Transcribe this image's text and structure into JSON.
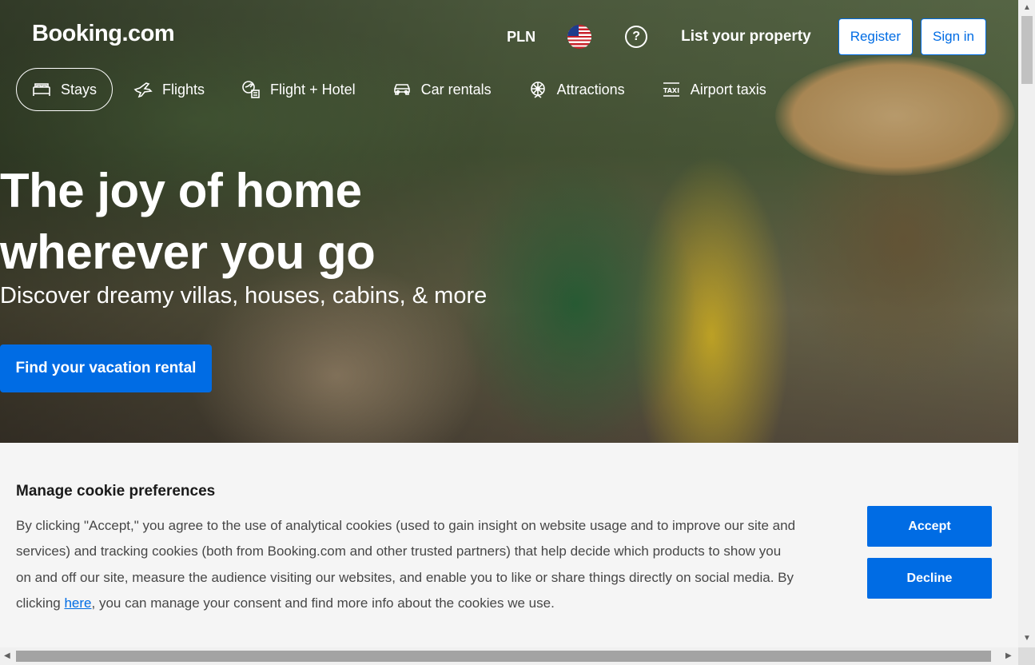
{
  "brand": {
    "logo": "Booking.com"
  },
  "header": {
    "currency": "PLN",
    "help_icon": "?",
    "list_property": "List your property",
    "register": "Register",
    "sign_in": "Sign in"
  },
  "nav": {
    "items": [
      {
        "label": "Stays",
        "icon": "bed-icon"
      },
      {
        "label": "Flights",
        "icon": "plane-icon"
      },
      {
        "label": "Flight + Hotel",
        "icon": "flight-hotel-icon"
      },
      {
        "label": "Car rentals",
        "icon": "car-icon"
      },
      {
        "label": "Attractions",
        "icon": "attractions-icon"
      },
      {
        "label": "Airport taxis",
        "icon": "taxi-icon"
      }
    ]
  },
  "hero": {
    "headline_line1": "The joy of home",
    "headline_line2": "wherever you go",
    "subtitle": "Discover dreamy villas, houses, cabins, & more",
    "cta": "Find your vacation rental"
  },
  "cookie": {
    "title": "Manage cookie preferences",
    "text_before_link": "By clicking \"Accept,\" you agree to the use of analytical cookies (used to gain insight on website usage and to improve our site and services) and tracking cookies (both from Booking.com and other trusted partners) that help decide which products to show you on and off our site, measure the audience visiting our websites, and enable you to like or share things directly on social media. By clicking ",
    "link": "here",
    "text_after_link": ", you can manage your consent and find more info about the cookies we use.",
    "accept": "Accept",
    "decline": "Decline"
  },
  "colors": {
    "brand_blue": "#006ce4",
    "white": "#ffffff"
  }
}
